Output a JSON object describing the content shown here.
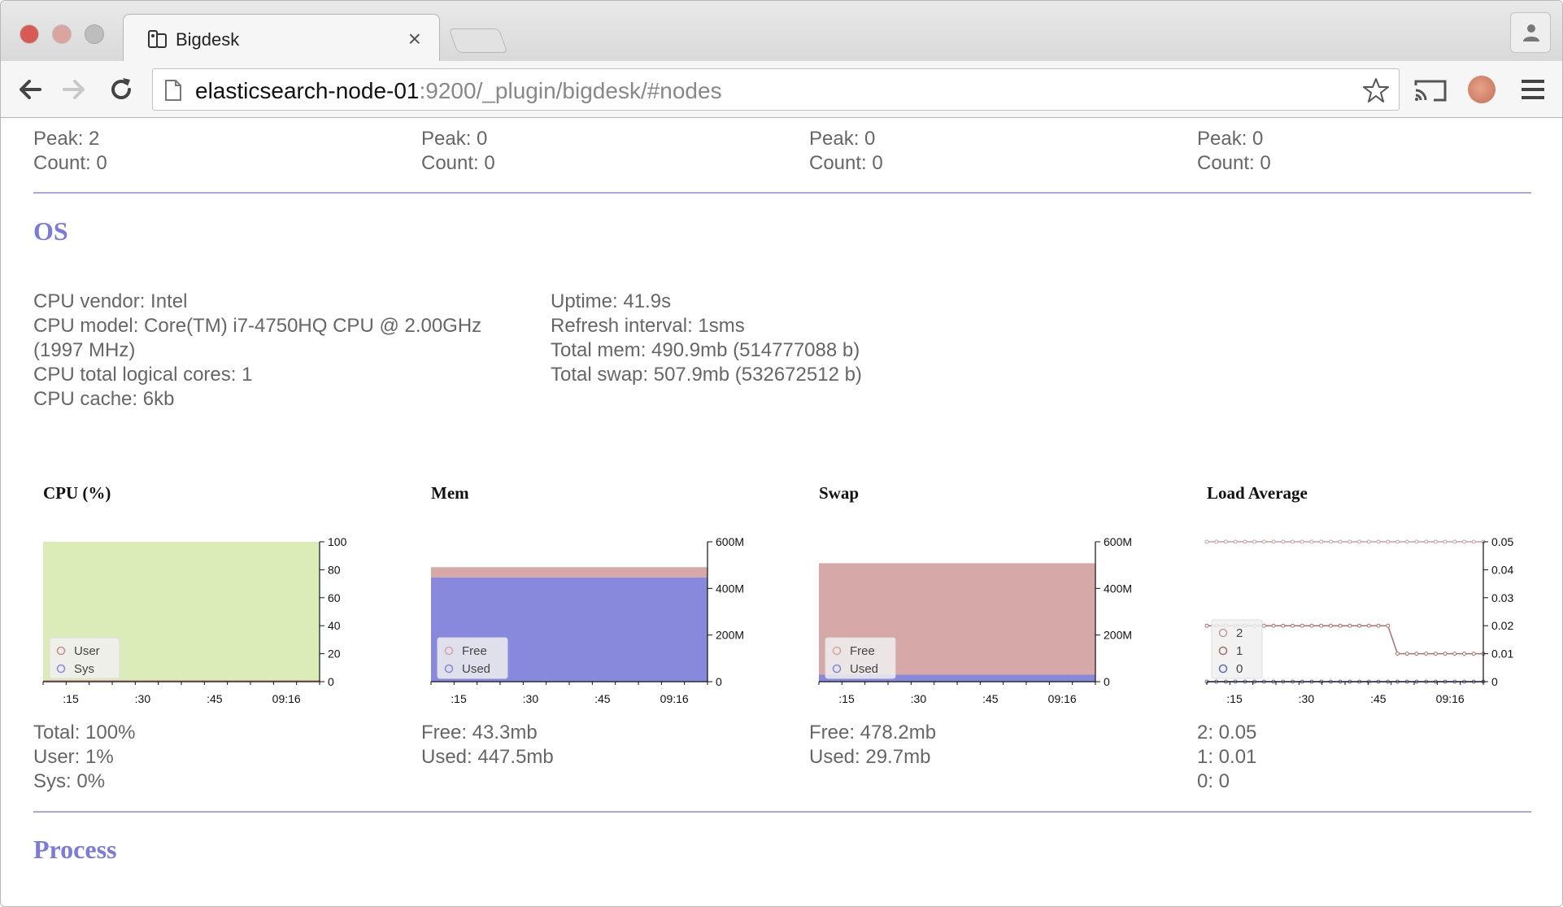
{
  "browser": {
    "tab_title": "Bigdesk",
    "tab_close": "×",
    "url_host": "elasticsearch-node-01",
    "url_rest": ":9200/_plugin/bigdesk/#nodes"
  },
  "threadpool_tail": [
    {
      "peak": "Peak: 2",
      "count": "Count: 0"
    },
    {
      "peak": "Peak: 0",
      "count": "Count: 0"
    },
    {
      "peak": "Peak: 0",
      "count": "Count: 0"
    },
    {
      "peak": "Peak: 0",
      "count": "Count: 0"
    }
  ],
  "os": {
    "title": "OS",
    "left": [
      "CPU vendor: Intel",
      "CPU model: Core(TM) i7-4750HQ CPU @ 2.00GHz",
      "(1997 MHz)",
      "CPU total logical cores: 1",
      "CPU cache: 6kb"
    ],
    "right": [
      "Uptime: 41.9s",
      "Refresh interval: 1sms",
      "Total mem: 490.9mb (514777088 b)",
      "Total swap: 507.9mb (532672512 b)"
    ]
  },
  "chart_data": [
    {
      "type": "area",
      "title": "CPU (%)",
      "x_ticks": [
        ":15",
        ":30",
        ":45",
        "09:16"
      ],
      "y_ticks": [
        "100",
        "80",
        "60",
        "40",
        "20",
        "0"
      ],
      "ylim": [
        0,
        100
      ],
      "legend": [
        "User",
        "Sys"
      ],
      "series": [
        {
          "name": "User",
          "values": [
            1,
            1,
            1,
            1,
            1,
            1,
            1,
            1,
            1,
            1
          ]
        },
        {
          "name": "Sys",
          "values": [
            0,
            0,
            0,
            0,
            0,
            0,
            0,
            0,
            0,
            0
          ]
        }
      ],
      "colors": {
        "background": "#dcecb8",
        "User": "#c98e8e",
        "Sys": "#8b8be0"
      }
    },
    {
      "type": "area",
      "title": "Mem",
      "x_ticks": [
        ":15",
        ":30",
        ":45",
        "09:16"
      ],
      "y_ticks": [
        "600M",
        "400M",
        "200M",
        "0"
      ],
      "ylim": [
        0,
        600
      ],
      "legend": [
        "Free",
        "Used"
      ],
      "series": [
        {
          "name": "Used",
          "values": [
            447.5,
            447.5
          ]
        },
        {
          "name": "Free",
          "values": [
            43.3,
            43.3
          ]
        }
      ],
      "colors": {
        "Free": "#d6a8a8",
        "Used": "#8888dd"
      }
    },
    {
      "type": "area",
      "title": "Swap",
      "x_ticks": [
        ":15",
        ":30",
        ":45",
        "09:16"
      ],
      "y_ticks": [
        "600M",
        "400M",
        "200M",
        "0"
      ],
      "ylim": [
        0,
        600
      ],
      "legend": [
        "Free",
        "Used"
      ],
      "series": [
        {
          "name": "Used",
          "values": [
            29.7,
            29.7
          ]
        },
        {
          "name": "Free",
          "values": [
            478.2,
            478.2
          ]
        }
      ],
      "colors": {
        "Free": "#d6a8a8",
        "Used": "#8888dd"
      }
    },
    {
      "type": "line",
      "title": "Load Average",
      "x_ticks": [
        ":15",
        ":30",
        ":45",
        "09:16"
      ],
      "y_ticks": [
        "0.05",
        "0.04",
        "0.03",
        "0.02",
        "0.01",
        "0"
      ],
      "ylim": [
        0,
        0.05
      ],
      "legend": [
        "2",
        "1",
        "0"
      ],
      "series": [
        {
          "name": "2",
          "values": [
            0.05,
            0.05,
            0.05,
            0.05,
            0.05,
            0.05,
            0.05,
            0.05,
            0.05,
            0.05,
            0.05,
            0.05,
            0.05,
            0.05,
            0.05,
            0.05,
            0.05,
            0.05,
            0.05,
            0.05,
            0.05,
            0.05,
            0.05,
            0.05,
            0.05,
            0.05,
            0.05,
            0.05,
            0.05,
            0.05
          ]
        },
        {
          "name": "1",
          "values": [
            0.02,
            0.02,
            0.02,
            0.02,
            0.02,
            0.02,
            0.02,
            0.02,
            0.02,
            0.02,
            0.02,
            0.02,
            0.02,
            0.02,
            0.02,
            0.02,
            0.02,
            0.02,
            0.02,
            0.02,
            0.01,
            0.01,
            0.01,
            0.01,
            0.01,
            0.01,
            0.01,
            0.01,
            0.01,
            0.01
          ]
        },
        {
          "name": "0",
          "values": [
            0,
            0,
            0,
            0,
            0,
            0,
            0,
            0,
            0,
            0,
            0,
            0,
            0,
            0,
            0,
            0,
            0,
            0,
            0,
            0,
            0,
            0,
            0,
            0,
            0,
            0,
            0,
            0,
            0,
            0
          ]
        }
      ],
      "colors": {
        "2": "#c9a0a0",
        "1": "#a87070",
        "0": "#6a6ab0"
      }
    }
  ],
  "os_stats": [
    [
      "Total: 100%",
      "User: 1%",
      "Sys: 0%"
    ],
    [
      "Free: 43.3mb",
      "Used: 447.5mb"
    ],
    [
      "Free: 478.2mb",
      "Used: 29.7mb"
    ],
    [
      "2: 0.05",
      "1: 0.01",
      "0: 0"
    ]
  ],
  "process": {
    "title": "Process"
  }
}
